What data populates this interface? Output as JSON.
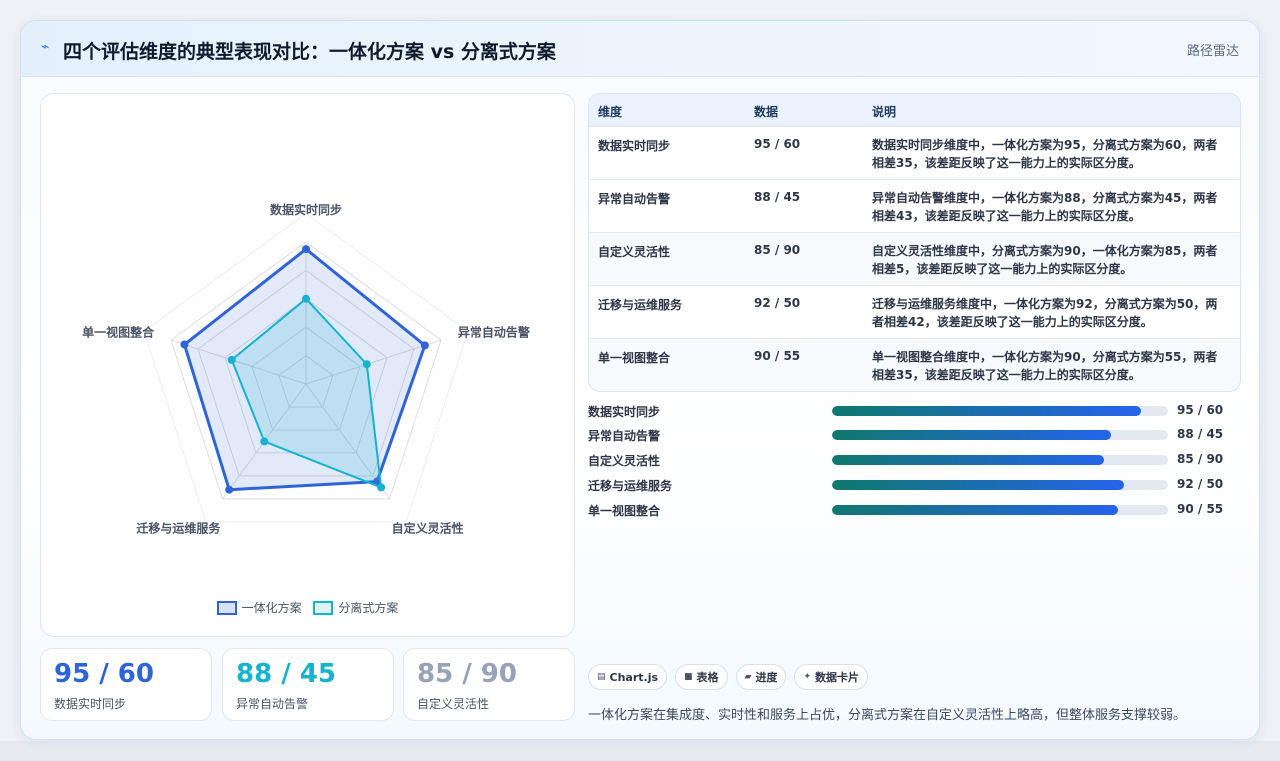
{
  "header": {
    "icon": "lightning-icon",
    "title": "四个评估维度的典型表现对比：一体化方案 vs 分离式方案",
    "tag": "路径雷达"
  },
  "chart_data": {
    "type": "radar",
    "categories": [
      "数据实时同步",
      "异常自动告警",
      "自定义灵活性",
      "迁移与运维服务",
      "单一视图整合"
    ],
    "series": [
      {
        "name": "一体化方案",
        "values": [
          95,
          88,
          85,
          92,
          90
        ],
        "color": "#2f64d8"
      },
      {
        "name": "分离式方案",
        "values": [
          60,
          45,
          90,
          50,
          55
        ],
        "color": "#14b3cf"
      }
    ],
    "range": [
      0,
      100
    ],
    "grid": true,
    "legend_position": "bottom"
  },
  "stats": [
    {
      "value": "95 / 60",
      "label": "数据实时同步",
      "color": "#2f64d8"
    },
    {
      "value": "88 / 45",
      "label": "异常自动告警",
      "color": "#14b3cf"
    },
    {
      "value": "85 / 90",
      "label": "自定义灵活性",
      "color": "#94a3b8"
    }
  ],
  "table": {
    "headers": [
      "维度",
      "数据",
      "说明"
    ],
    "rows": [
      {
        "dim": "数据实时同步",
        "data": "95 / 60",
        "desc": "数据实时同步维度中，一体化方案为95，分离式方案为60，两者相差35，该差距反映了这一能力上的实际区分度。"
      },
      {
        "dim": "异常自动告警",
        "data": "88 / 45",
        "desc": "异常自动告警维度中，一体化方案为88，分离式方案为45，两者相差43，该差距反映了这一能力上的实际区分度。"
      },
      {
        "dim": "自定义灵活性",
        "data": "85 / 90",
        "desc": "自定义灵活性维度中，分离式方案为90，一体化方案为85，两者相差5，该差距反映了这一能力上的实际区分度。"
      },
      {
        "dim": "迁移与运维服务",
        "data": "92 / 50",
        "desc": "迁移与运维服务维度中，一体化方案为92，分离式方案为50，两者相差42，该差距反映了这一能力上的实际区分度。"
      },
      {
        "dim": "单一视图整合",
        "data": "90 / 55",
        "desc": "单一视图整合维度中，一体化方案为90，分离式方案为55，两者相差35，该差距反映了这一能力上的实际区分度。"
      }
    ]
  },
  "progress": [
    {
      "label": "数据实时同步",
      "fraction": 0.92,
      "value": "95 / 60"
    },
    {
      "label": "异常自动告警",
      "fraction": 0.83,
      "value": "88 / 45"
    },
    {
      "label": "自定义灵活性",
      "fraction": 0.81,
      "value": "85 / 90"
    },
    {
      "label": "迁移与运维服务",
      "fraction": 0.87,
      "value": "92 / 50"
    },
    {
      "label": "单一视图整合",
      "fraction": 0.85,
      "value": "90 / 55"
    }
  ],
  "chips": [
    {
      "icon": "chart-icon",
      "glyph": "▤",
      "label": "Chart.js"
    },
    {
      "icon": "table-icon",
      "glyph": "■",
      "label": "表格"
    },
    {
      "icon": "progress-icon",
      "glyph": "▰",
      "label": "进度"
    },
    {
      "icon": "card-icon",
      "glyph": "✦",
      "label": "数据卡片"
    }
  ],
  "summary": "一体化方案在集成度、实时性和服务上占优，分离式方案在自定义灵活性上略高，但整体服务支撑较弱。"
}
